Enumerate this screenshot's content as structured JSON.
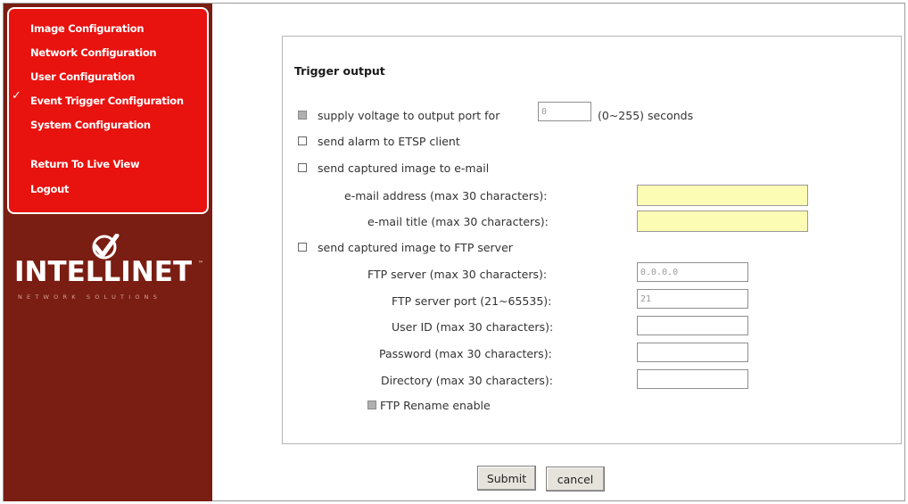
{
  "menu": {
    "items": [
      {
        "label": "Image Configuration"
      },
      {
        "label": "Network Configuration"
      },
      {
        "label": "User Configuration"
      },
      {
        "label": "Event Trigger Configuration"
      },
      {
        "label": "System Configuration"
      },
      {
        "label": "Return To Live View"
      },
      {
        "label": "Logout"
      }
    ],
    "check_symbol": "✓"
  },
  "logo": {
    "name": "INTELLINET",
    "tm": "™",
    "tagline": "NETWORK SOLUTIONS"
  },
  "form": {
    "heading": "Trigger output",
    "supply_voltage": {
      "label": "supply voltage to output port for",
      "value": "0",
      "suffix": "(0~255) seconds"
    },
    "send_alarm": {
      "label": "send alarm to ETSP client"
    },
    "send_email": {
      "label": "send captured image to e-mail"
    },
    "email_address": {
      "label": "e-mail address (max 30 characters):",
      "value": ""
    },
    "email_title": {
      "label": "e-mail title (max 30 characters):",
      "value": ""
    },
    "send_ftp": {
      "label": "send captured image to FTP server"
    },
    "ftp_server": {
      "label": "FTP server (max 30 characters):",
      "value": "0.0.0.0"
    },
    "ftp_port": {
      "label": "FTP server port (21~65535):",
      "value": "21"
    },
    "user_id": {
      "label": "User ID (max 30 characters):",
      "value": ""
    },
    "password": {
      "label": "Password (max 30 characters):",
      "value": ""
    },
    "directory": {
      "label": "Directory (max 30 characters):",
      "value": ""
    },
    "ftp_rename": {
      "label": "FTP Rename enable"
    }
  },
  "buttons": {
    "submit": "Submit",
    "cancel": "cancel"
  },
  "colors": {
    "menu_bg": "#e8120f",
    "sidebar_bg": "#7a1d12",
    "input_highlight": "#fdfcb4"
  }
}
